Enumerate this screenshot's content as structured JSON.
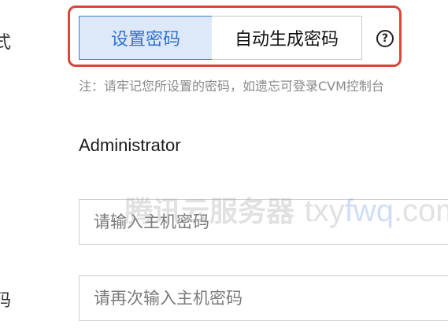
{
  "left_labels": {
    "top": "式",
    "bottom": "码"
  },
  "password_mode": {
    "options": [
      "设置密码",
      "自动生成密码"
    ],
    "selected": "设置密码"
  },
  "help_icon": {
    "glyph": "?"
  },
  "note": "注：请牢记您所设置的密码，如遗忘可登录CVM控制台",
  "username": "Administrator",
  "password_field": {
    "placeholder": "请输入主机密码"
  },
  "confirm_field": {
    "placeholder": "请再次输入主机密码"
  },
  "watermark": {
    "cn": "腾讯云服务器",
    "latin_a": "txy",
    "latin_b": "fwq",
    "latin_c": ".com"
  },
  "colors": {
    "accent": "#2e72d2",
    "selected_bg": "#dde9f9",
    "highlight_frame": "#d9463a"
  }
}
